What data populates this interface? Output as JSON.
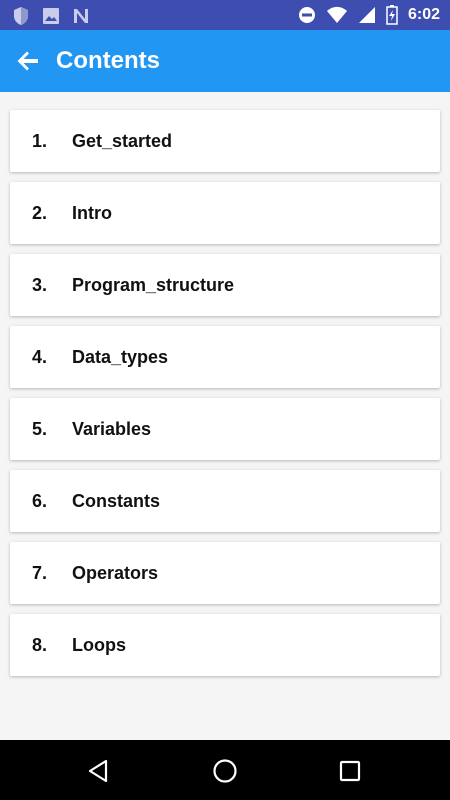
{
  "status_bar": {
    "time": "6:02",
    "left_icons": [
      "shield-icon",
      "image-icon",
      "notification-n-icon"
    ],
    "right_icons": [
      "do-not-disturb-icon",
      "wifi-icon",
      "signal-icon",
      "battery-icon"
    ]
  },
  "app_bar": {
    "title": "Contents",
    "color": "#2196f3",
    "back_icon": "arrow-back-icon"
  },
  "contents": {
    "items": [
      {
        "number": "1.",
        "label": "Get_started"
      },
      {
        "number": "2.",
        "label": "Intro"
      },
      {
        "number": "3.",
        "label": "Program_structure"
      },
      {
        "number": "4.",
        "label": "Data_types"
      },
      {
        "number": "5.",
        "label": "Variables"
      },
      {
        "number": "6.",
        "label": "Constants"
      },
      {
        "number": "7.",
        "label": "Operators"
      },
      {
        "number": "8.",
        "label": "Loops"
      }
    ]
  },
  "nav_bar": {
    "buttons": [
      "back-triangle-icon",
      "home-circle-icon",
      "recents-square-icon"
    ]
  }
}
